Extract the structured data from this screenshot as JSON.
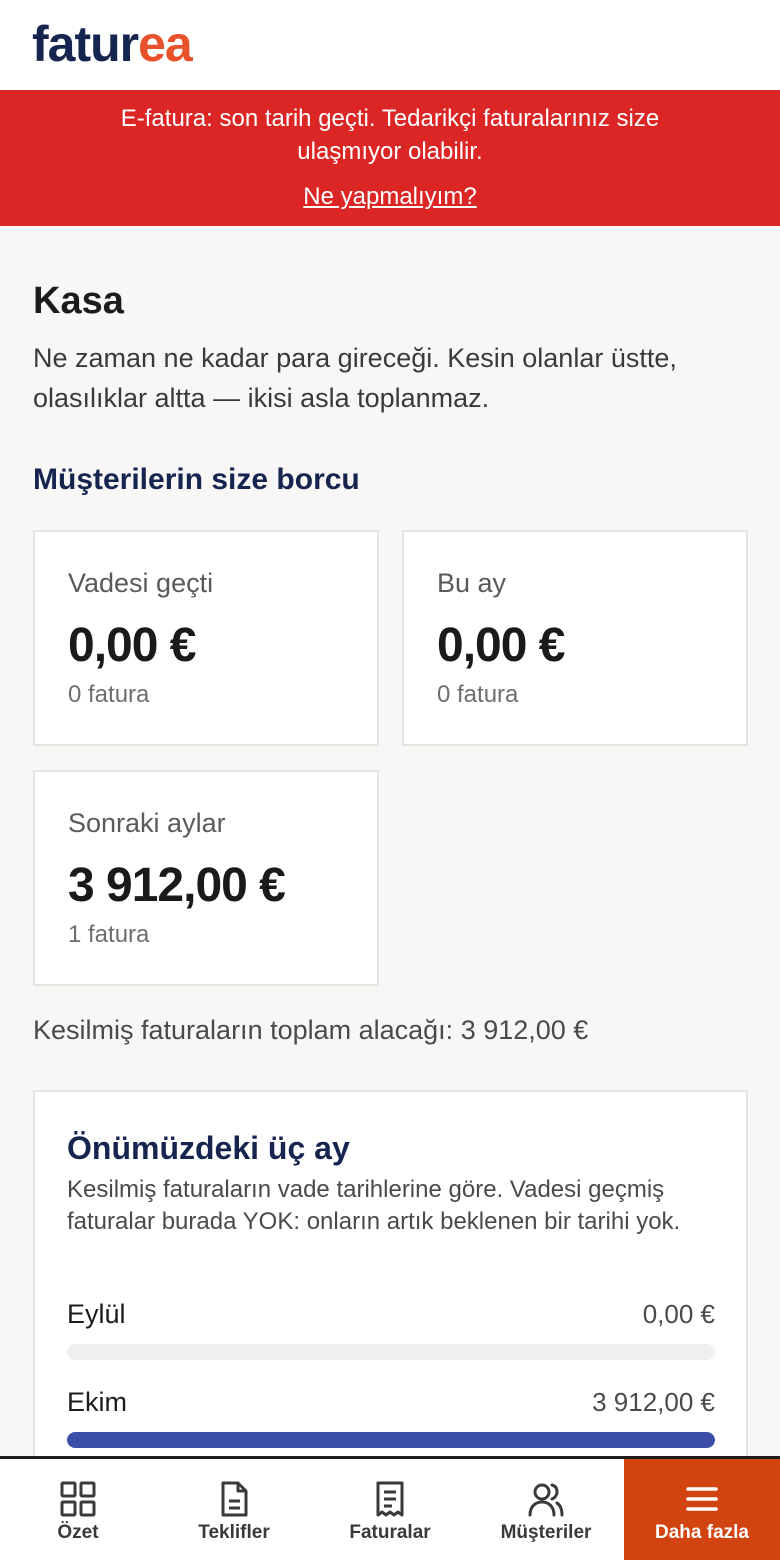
{
  "brand": {
    "part1": "fatur",
    "part2": "ea"
  },
  "alert": {
    "message": "E-fatura: son tarih geçti. Tedarikçi faturalarınız size ulaşmıyor olabilir.",
    "link": "Ne yapmalıyım?"
  },
  "page": {
    "title": "Kasa",
    "subtitle": "Ne zaman ne kadar para gireceği. Kesin olanlar üstte, olasılıklar altta — ikisi asla toplanmaz."
  },
  "receivables": {
    "title": "Müşterilerin size borcu",
    "cards": [
      {
        "label": "Vadesi geçti",
        "amount": "0,00 €",
        "count": "0 fatura"
      },
      {
        "label": "Bu ay",
        "amount": "0,00 €",
        "count": "0 fatura"
      },
      {
        "label": "Sonraki aylar",
        "amount": "3 912,00 €",
        "count": "1 fatura"
      }
    ],
    "total": "Kesilmiş faturaların toplam alacağı: 3 912,00 €"
  },
  "forecast": {
    "title": "Önümüzdeki üç ay",
    "description": "Kesilmiş faturaların vade tarihlerine göre. Vadesi geçmiş faturalar burada YOK: onların artık beklenen bir tarihi yok.",
    "months": [
      {
        "month": "Eylül",
        "amount": "0,00 €",
        "fill": 0
      },
      {
        "month": "Ekim",
        "amount": "3 912,00 €",
        "fill": 1
      }
    ],
    "bar_color": "#3b4fa8"
  },
  "nav": {
    "items": [
      {
        "label": "Özet",
        "icon": "grid-icon"
      },
      {
        "label": "Teklifler",
        "icon": "document-icon"
      },
      {
        "label": "Faturalar",
        "icon": "receipt-icon"
      },
      {
        "label": "Müşteriler",
        "icon": "users-icon"
      },
      {
        "label": "Daha fazla",
        "icon": "menu-icon"
      }
    ],
    "active_index": 4,
    "active_color": "#d2440f"
  },
  "colors": {
    "alert": "#dc2626",
    "navy": "#16254f",
    "brand_orange": "#e8522a"
  }
}
